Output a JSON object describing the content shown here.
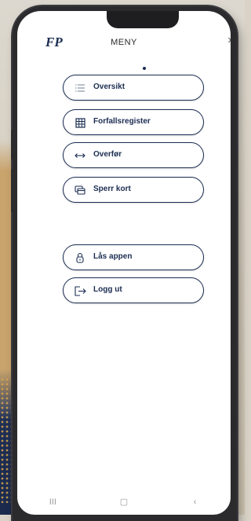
{
  "header": {
    "logo_text": "FP",
    "title": "MENY",
    "close_glyph": "×"
  },
  "menu_items": [
    {
      "label": "Oversikt",
      "icon": "list-icon"
    },
    {
      "label": "Forfallsregister",
      "icon": "calendar-icon"
    },
    {
      "label": "Overfør",
      "icon": "transfer-arrows-icon"
    },
    {
      "label": "Sperr kort",
      "icon": "card-block-icon"
    },
    {
      "label": "Lås appen",
      "icon": "lock-icon"
    },
    {
      "label": "Logg ut",
      "icon": "logout-icon"
    }
  ],
  "nav_bar": {
    "recent": "III",
    "home": "▢",
    "back": "‹"
  },
  "colors": {
    "accent": "#1b2d52",
    "phone_body": "#2b2b2e",
    "screen_bg": "#ffffff"
  }
}
